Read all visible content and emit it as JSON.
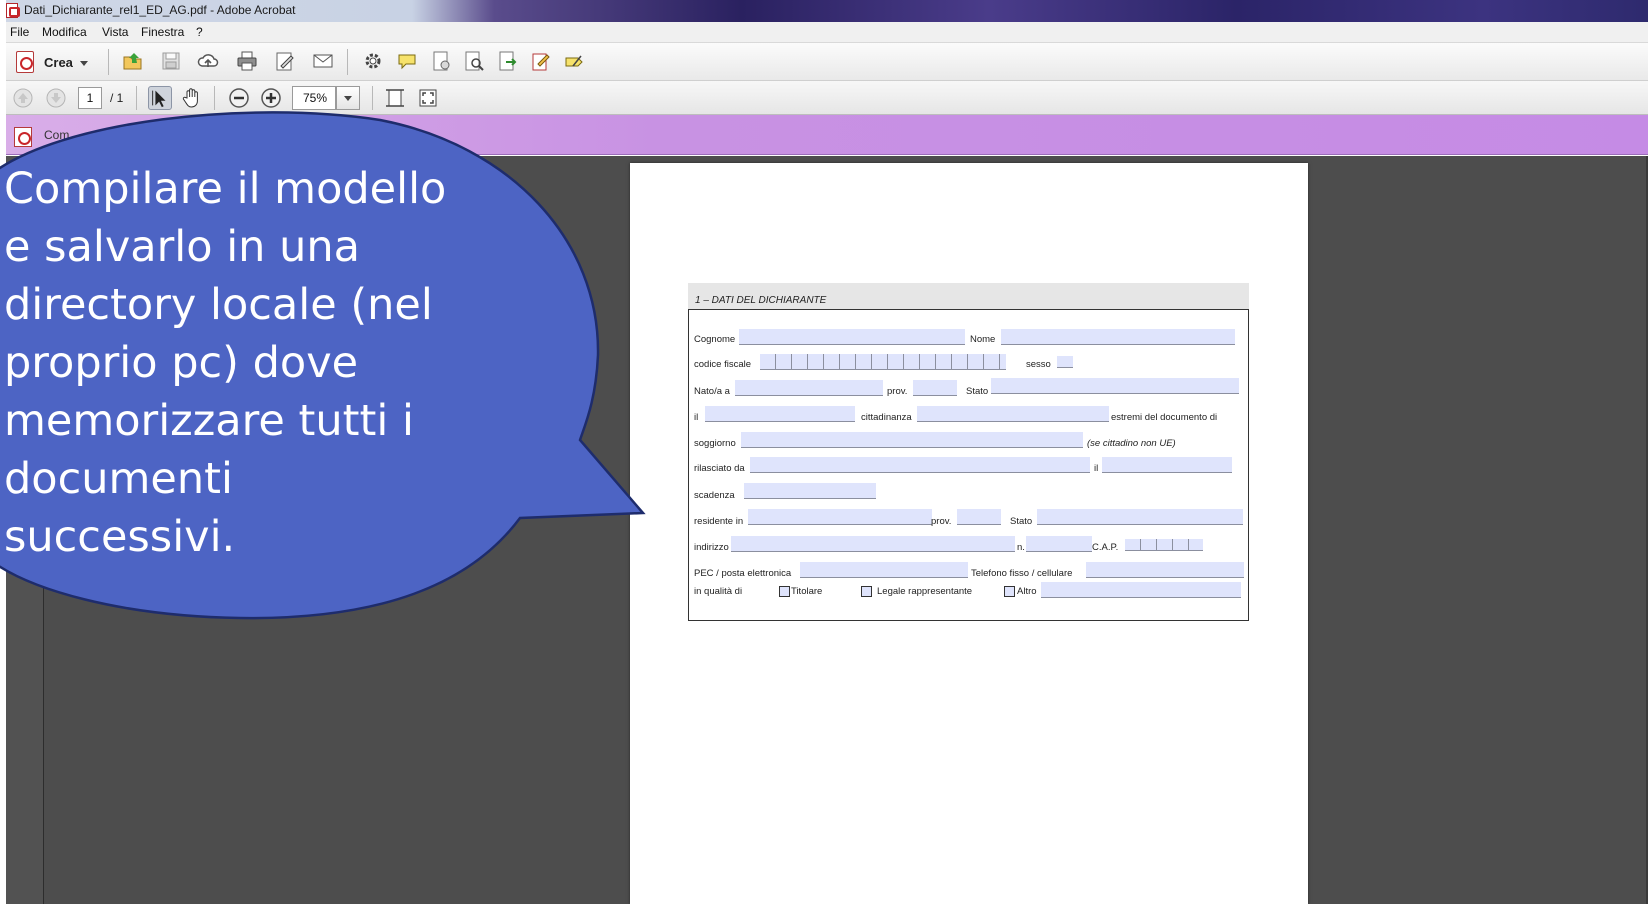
{
  "window": {
    "title": "Dati_Dichiarante_rel1_ED_AG.pdf - Adobe Acrobat"
  },
  "menu": {
    "items": [
      "File",
      "Modifica",
      "Vista",
      "Finestra",
      "?"
    ]
  },
  "toolbar": {
    "create_label": "Crea",
    "icons": [
      "open-folder-icon",
      "save-icon",
      "cloud-upload-icon",
      "print-icon",
      "edit-document-icon",
      "email-icon",
      "settings-gear-icon",
      "comment-bubble-icon",
      "document-icon",
      "find-document-icon",
      "export-icon",
      "sign-icon",
      "tag-pen-icon"
    ]
  },
  "navigation": {
    "page_current": "1",
    "page_total": "/ 1",
    "zoom_value": "75%"
  },
  "forms_bar": {
    "text": "Com"
  },
  "form": {
    "section_title": "1 – DATI DEL DICHIARANTE",
    "labels": {
      "cognome": "Cognome",
      "nome": "Nome",
      "codice_fiscale": "codice fiscale",
      "sesso": "sesso",
      "nato_a": "Nato/a a",
      "prov": "prov.",
      "stato": "Stato",
      "il": "il",
      "cittadinanza": "cittadinanza",
      "estremi": "estremi del documento di",
      "soggiorno": "soggiorno",
      "se_cittadino": "(se cittadino non UE)",
      "rilasciato_da": "rilasciato da",
      "il2": "il",
      "scadenza": "scadenza",
      "residente_in": "residente in",
      "prov2": "prov.",
      "stato2": "Stato",
      "indirizzo": "indirizzo",
      "n": "n.",
      "cap": "C.A.P.",
      "pec": "PEC / posta elettronica",
      "telefono": "Telefono fisso / cellulare",
      "in_qualita": "in qualità di",
      "titolare": "Titolare",
      "legale": "Legale rappresentante",
      "altro": "Altro"
    }
  },
  "callout": {
    "text": "Compilare il modello e salvarlo in una directory locale (nel proprio pc) dove memorizzare tutti i documenti successivi.",
    "fill_color": "#4d64c4",
    "stroke_color": "#1e2c6c"
  }
}
